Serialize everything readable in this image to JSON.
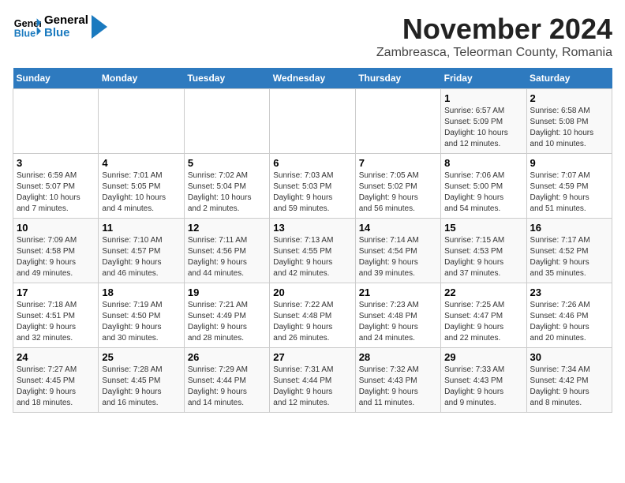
{
  "logo": {
    "line1": "General",
    "line2": "Blue"
  },
  "title": "November 2024",
  "location": "Zambreasca, Teleorman County, Romania",
  "weekdays": [
    "Sunday",
    "Monday",
    "Tuesday",
    "Wednesday",
    "Thursday",
    "Friday",
    "Saturday"
  ],
  "weeks": [
    [
      {
        "day": "",
        "info": ""
      },
      {
        "day": "",
        "info": ""
      },
      {
        "day": "",
        "info": ""
      },
      {
        "day": "",
        "info": ""
      },
      {
        "day": "",
        "info": ""
      },
      {
        "day": "1",
        "info": "Sunrise: 6:57 AM\nSunset: 5:09 PM\nDaylight: 10 hours\nand 12 minutes."
      },
      {
        "day": "2",
        "info": "Sunrise: 6:58 AM\nSunset: 5:08 PM\nDaylight: 10 hours\nand 10 minutes."
      }
    ],
    [
      {
        "day": "3",
        "info": "Sunrise: 6:59 AM\nSunset: 5:07 PM\nDaylight: 10 hours\nand 7 minutes."
      },
      {
        "day": "4",
        "info": "Sunrise: 7:01 AM\nSunset: 5:05 PM\nDaylight: 10 hours\nand 4 minutes."
      },
      {
        "day": "5",
        "info": "Sunrise: 7:02 AM\nSunset: 5:04 PM\nDaylight: 10 hours\nand 2 minutes."
      },
      {
        "day": "6",
        "info": "Sunrise: 7:03 AM\nSunset: 5:03 PM\nDaylight: 9 hours\nand 59 minutes."
      },
      {
        "day": "7",
        "info": "Sunrise: 7:05 AM\nSunset: 5:02 PM\nDaylight: 9 hours\nand 56 minutes."
      },
      {
        "day": "8",
        "info": "Sunrise: 7:06 AM\nSunset: 5:00 PM\nDaylight: 9 hours\nand 54 minutes."
      },
      {
        "day": "9",
        "info": "Sunrise: 7:07 AM\nSunset: 4:59 PM\nDaylight: 9 hours\nand 51 minutes."
      }
    ],
    [
      {
        "day": "10",
        "info": "Sunrise: 7:09 AM\nSunset: 4:58 PM\nDaylight: 9 hours\nand 49 minutes."
      },
      {
        "day": "11",
        "info": "Sunrise: 7:10 AM\nSunset: 4:57 PM\nDaylight: 9 hours\nand 46 minutes."
      },
      {
        "day": "12",
        "info": "Sunrise: 7:11 AM\nSunset: 4:56 PM\nDaylight: 9 hours\nand 44 minutes."
      },
      {
        "day": "13",
        "info": "Sunrise: 7:13 AM\nSunset: 4:55 PM\nDaylight: 9 hours\nand 42 minutes."
      },
      {
        "day": "14",
        "info": "Sunrise: 7:14 AM\nSunset: 4:54 PM\nDaylight: 9 hours\nand 39 minutes."
      },
      {
        "day": "15",
        "info": "Sunrise: 7:15 AM\nSunset: 4:53 PM\nDaylight: 9 hours\nand 37 minutes."
      },
      {
        "day": "16",
        "info": "Sunrise: 7:17 AM\nSunset: 4:52 PM\nDaylight: 9 hours\nand 35 minutes."
      }
    ],
    [
      {
        "day": "17",
        "info": "Sunrise: 7:18 AM\nSunset: 4:51 PM\nDaylight: 9 hours\nand 32 minutes."
      },
      {
        "day": "18",
        "info": "Sunrise: 7:19 AM\nSunset: 4:50 PM\nDaylight: 9 hours\nand 30 minutes."
      },
      {
        "day": "19",
        "info": "Sunrise: 7:21 AM\nSunset: 4:49 PM\nDaylight: 9 hours\nand 28 minutes."
      },
      {
        "day": "20",
        "info": "Sunrise: 7:22 AM\nSunset: 4:48 PM\nDaylight: 9 hours\nand 26 minutes."
      },
      {
        "day": "21",
        "info": "Sunrise: 7:23 AM\nSunset: 4:48 PM\nDaylight: 9 hours\nand 24 minutes."
      },
      {
        "day": "22",
        "info": "Sunrise: 7:25 AM\nSunset: 4:47 PM\nDaylight: 9 hours\nand 22 minutes."
      },
      {
        "day": "23",
        "info": "Sunrise: 7:26 AM\nSunset: 4:46 PM\nDaylight: 9 hours\nand 20 minutes."
      }
    ],
    [
      {
        "day": "24",
        "info": "Sunrise: 7:27 AM\nSunset: 4:45 PM\nDaylight: 9 hours\nand 18 minutes."
      },
      {
        "day": "25",
        "info": "Sunrise: 7:28 AM\nSunset: 4:45 PM\nDaylight: 9 hours\nand 16 minutes."
      },
      {
        "day": "26",
        "info": "Sunrise: 7:29 AM\nSunset: 4:44 PM\nDaylight: 9 hours\nand 14 minutes."
      },
      {
        "day": "27",
        "info": "Sunrise: 7:31 AM\nSunset: 4:44 PM\nDaylight: 9 hours\nand 12 minutes."
      },
      {
        "day": "28",
        "info": "Sunrise: 7:32 AM\nSunset: 4:43 PM\nDaylight: 9 hours\nand 11 minutes."
      },
      {
        "day": "29",
        "info": "Sunrise: 7:33 AM\nSunset: 4:43 PM\nDaylight: 9 hours\nand 9 minutes."
      },
      {
        "day": "30",
        "info": "Sunrise: 7:34 AM\nSunset: 4:42 PM\nDaylight: 9 hours\nand 8 minutes."
      }
    ]
  ]
}
